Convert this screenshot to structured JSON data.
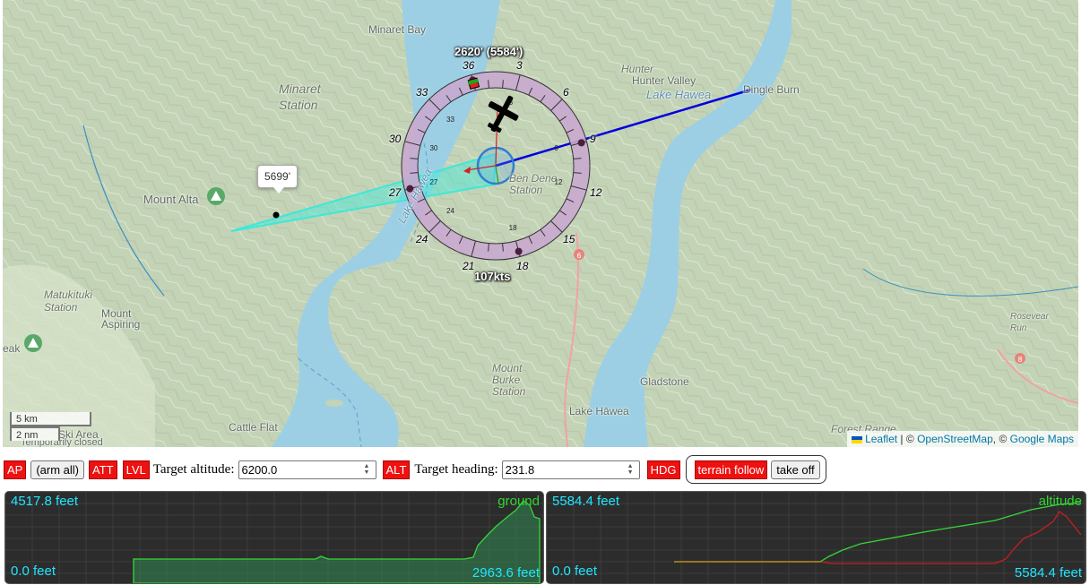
{
  "map": {
    "places": [
      {
        "id": "minaret-bay",
        "text": "Minaret Bay",
        "style": "normal"
      },
      {
        "id": "minaret-station",
        "text": "Minaret Station",
        "style": "italic-big"
      },
      {
        "id": "hunter-valley",
        "text": "Hunter Valley",
        "style": "normal"
      },
      {
        "id": "lake-hawea-top",
        "text": "Lake Hawea",
        "style": "water"
      },
      {
        "id": "dingle-burn",
        "text": "Dingle Burn",
        "style": "normal"
      },
      {
        "id": "mount-alta",
        "text": "Mount Alta",
        "style": "normal"
      },
      {
        "id": "ben-dene-station",
        "text": "Ben Dene Station",
        "style": "italic"
      },
      {
        "id": "lake-hawea-vert",
        "text": "Lake Hawea",
        "style": "water"
      },
      {
        "id": "matukituki-station",
        "text": "Matukituki Station",
        "style": "italic"
      },
      {
        "id": "mount-aspiring",
        "text": "Mount Aspiring",
        "style": "normal"
      },
      {
        "id": "mount-burke-station",
        "text": "Mount Burke Station",
        "style": "italic"
      },
      {
        "id": "gladstone",
        "text": "Gladstone",
        "style": "normal"
      },
      {
        "id": "lake-hawea-town",
        "text": "Lake Hāwea",
        "style": "normal"
      },
      {
        "id": "cattle-flat",
        "text": "Cattle Flat",
        "style": "normal"
      },
      {
        "id": "ski-area",
        "text": "Ski Area",
        "style": "normal"
      },
      {
        "id": "temporarily-closed",
        "text": "Temporarily closed",
        "style": "normal"
      },
      {
        "id": "forest-range",
        "text": "Forest Range",
        "style": "italic"
      },
      {
        "id": "rosevear-run",
        "text": "Rosevear Run",
        "style": "italic"
      },
      {
        "id": "peak",
        "text": "eak",
        "style": "normal"
      },
      {
        "id": "hunter",
        "text": "Hunter",
        "style": "italic"
      }
    ],
    "hud": {
      "altitude_label": "2620' (5584')",
      "speed_label": "107kts",
      "compass_outer_labels": [
        "33",
        "36",
        "3",
        "6",
        "9",
        "12",
        "15",
        "18",
        "21",
        "24",
        "27",
        "30"
      ],
      "compass_inner_labels": [
        "33",
        "3",
        "9",
        "12",
        "18",
        "24",
        "27",
        "30"
      ]
    },
    "tooltip": "5699'",
    "scale": {
      "km": "5 km",
      "nm": "2 nm"
    },
    "attribution": {
      "leaflet": "Leaflet",
      "sep1": " | © ",
      "osm": "OpenStreetMap",
      "sep2": ", © ",
      "google": "Google Maps"
    }
  },
  "controls": {
    "ap": "AP",
    "arm_all": "(arm all)",
    "att": "ATT",
    "lvl": "LVL",
    "target_altitude_label": "Target altitude:",
    "target_altitude_value": "6200.0",
    "alt": "ALT",
    "target_heading_label": "Target heading:",
    "target_heading_value": "231.8",
    "hdg": "HDG",
    "terrain_follow": "terrain follow",
    "take_off": "take off"
  },
  "charts": {
    "ground": {
      "max_label": "4517.8 feet",
      "min_label": "0.0 feet",
      "current_label": "2963.6 feet",
      "series_label": "ground"
    },
    "altitude": {
      "max_label": "5584.4 feet",
      "min_label": "0.0 feet",
      "current_label": "5584.4 feet",
      "series_label": "altitude"
    }
  },
  "colors": {
    "toggle_red": "#ee1111",
    "chart_bg": "#2c2c2c",
    "label_cyan": "#1fe6ff",
    "series_green": "#2fd62f",
    "ground_red": "#c81e1e",
    "route_blue": "#0000dd",
    "cone_cyan": "#3de8d8",
    "lake": "#9ccfe4"
  },
  "icons": [
    "airplane-icon",
    "mountain-peak-icon",
    "ukraine-flag-icon",
    "spinner-arrows-icon",
    "compass-icon"
  ]
}
